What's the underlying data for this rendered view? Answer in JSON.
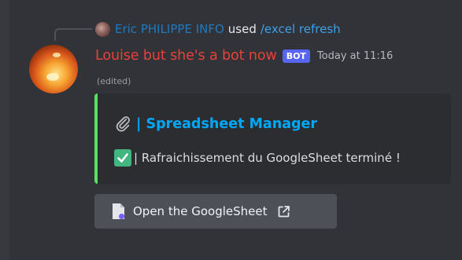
{
  "reply": {
    "user": "Eric PHILIPPE INFO",
    "used": "used",
    "command": "/excel refresh"
  },
  "message": {
    "username": "Louise but she's a bot now",
    "badge": "BOT",
    "timestamp": "Today at 11:16",
    "edited": "(edited)"
  },
  "embed": {
    "title": "| Spreadsheet Manager",
    "description": "| Rafraichissement du GoogleSheet terminé !",
    "accent_color": "#57e35f"
  },
  "button": {
    "label": "Open the GoogleSheet"
  },
  "icons": {
    "title_icon": "paperclip-icon",
    "desc_icon": "check-mark-icon",
    "button_icon": "document-icon",
    "button_suffix_icon": "external-link-icon"
  }
}
